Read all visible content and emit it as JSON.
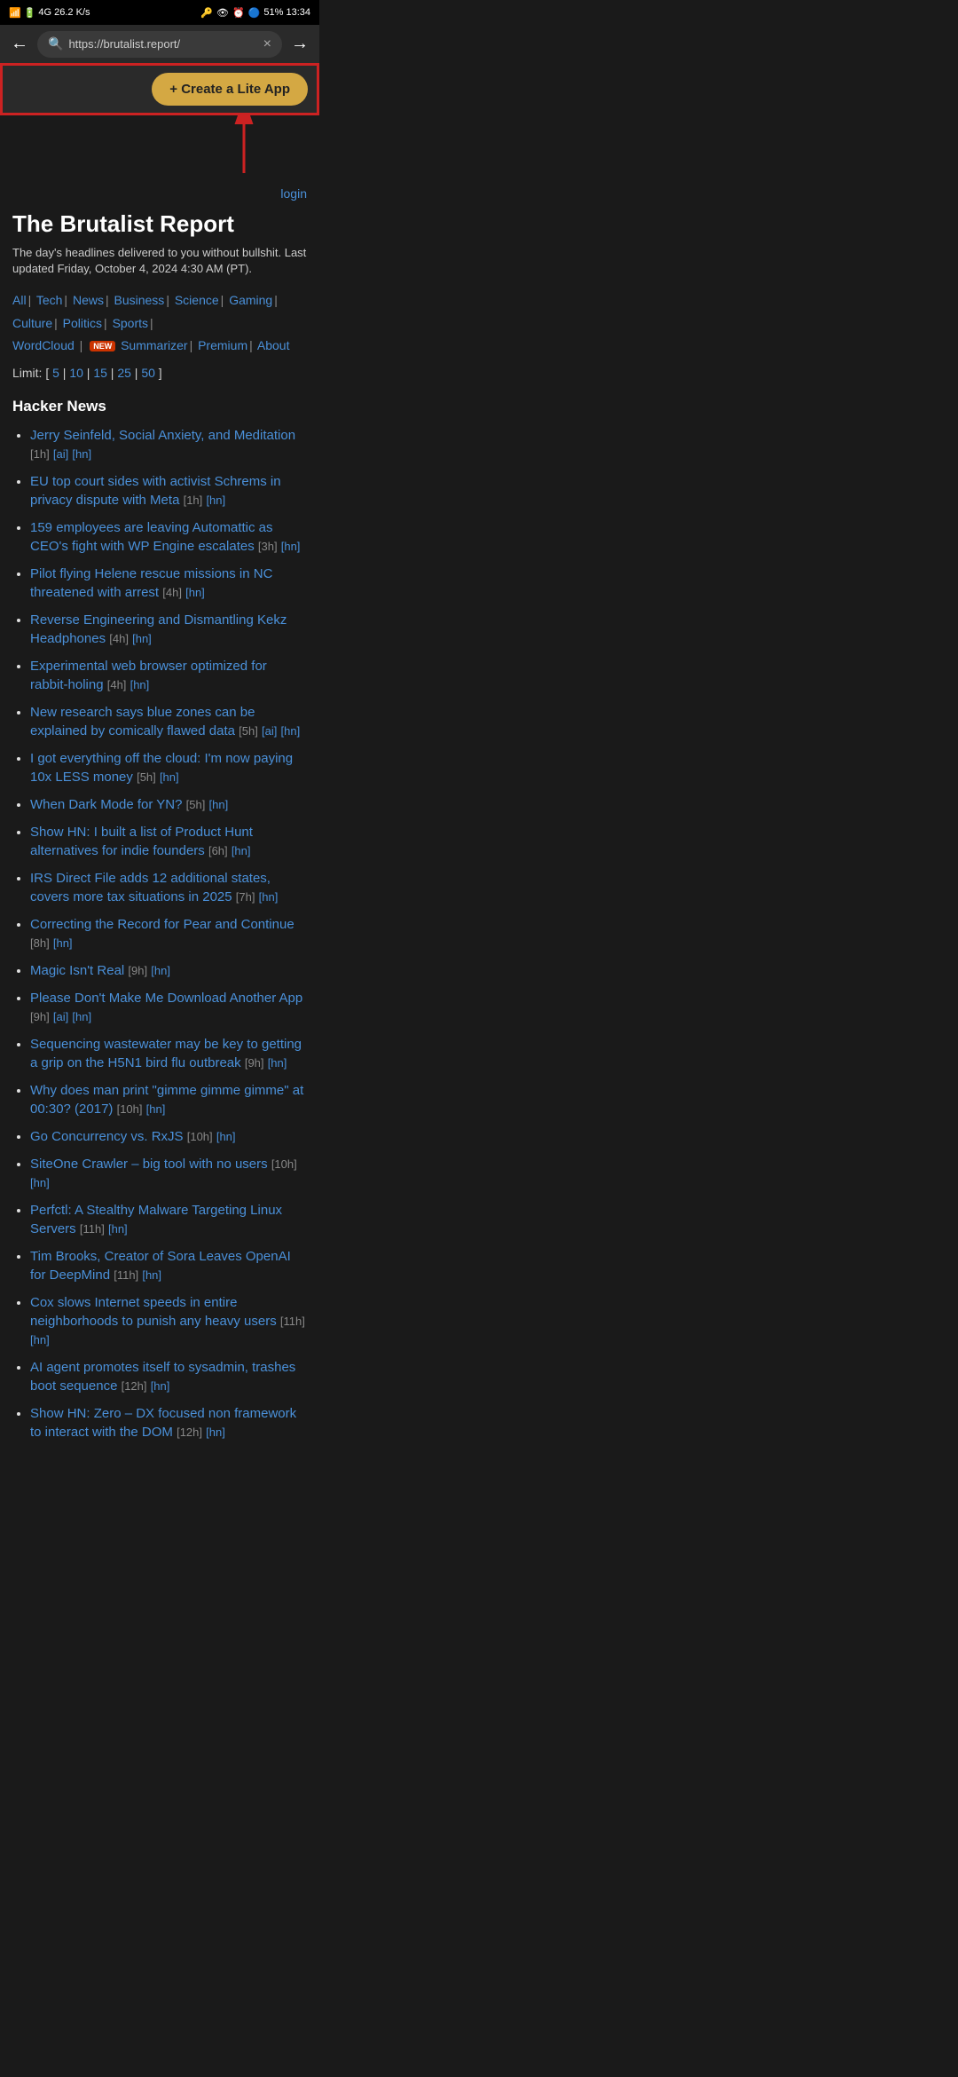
{
  "statusBar": {
    "left": "4G 26.2 K/s",
    "right": "51% 13:34"
  },
  "browser": {
    "url": "https://brutalist.report/",
    "backLabel": "←",
    "forwardLabel": "→",
    "closeLabel": "×"
  },
  "createAppBtn": {
    "label": "+ Create a Lite App"
  },
  "page": {
    "loginLabel": "login",
    "siteTitle": "The Brutalist Report",
    "siteDesc": "The day's headlines delivered to you without bullshit. Last updated Friday, October 4, 2024 4:30 AM (PT).",
    "navItems": [
      "All",
      "Tech",
      "News",
      "Business",
      "Science",
      "Gaming",
      "Culture",
      "Politics",
      "Sports",
      "WordCloud",
      "Summarizer",
      "Premium",
      "About"
    ],
    "limitLabel": "Limit:",
    "limitOptions": [
      "5",
      "10",
      "15",
      "25",
      "50"
    ],
    "hackerNewsTitle": "Hacker News",
    "newsItems": [
      {
        "title": "Jerry Seinfeld, Social Anxiety, and Meditation",
        "time": "1h",
        "tags": [
          "ai",
          "hn"
        ]
      },
      {
        "title": "EU top court sides with activist Schrems in privacy dispute with Meta",
        "time": "1h",
        "tags": [
          "hn"
        ]
      },
      {
        "title": "159 employees are leaving Automattic as CEO's fight with WP Engine escalates",
        "time": "3h",
        "tags": [
          "hn"
        ]
      },
      {
        "title": "Pilot flying Helene rescue missions in NC threatened with arrest",
        "time": "4h",
        "tags": [
          "hn"
        ]
      },
      {
        "title": "Reverse Engineering and Dismantling Kekz Headphones",
        "time": "4h",
        "tags": [
          "hn"
        ]
      },
      {
        "title": "Experimental web browser optimized for rabbit-holing",
        "time": "4h",
        "tags": [
          "hn"
        ]
      },
      {
        "title": "New research says blue zones can be explained by comically flawed data",
        "time": "5h",
        "tags": [
          "ai",
          "hn"
        ]
      },
      {
        "title": "I got everything off the cloud: I'm now paying 10x LESS money",
        "time": "5h",
        "tags": [
          "hn"
        ]
      },
      {
        "title": "When Dark Mode for YN?",
        "time": "5h",
        "tags": [
          "hn"
        ]
      },
      {
        "title": "Show HN: I built a list of Product Hunt alternatives for indie founders",
        "time": "6h",
        "tags": [
          "hn"
        ]
      },
      {
        "title": "IRS Direct File adds 12 additional states, covers more tax situations in 2025",
        "time": "7h",
        "tags": [
          "hn"
        ]
      },
      {
        "title": "Correcting the Record for Pear and Continue",
        "time": "8h",
        "tags": [
          "hn"
        ]
      },
      {
        "title": "Magic Isn't Real",
        "time": "9h",
        "tags": [
          "hn"
        ]
      },
      {
        "title": "Please Don't Make Me Download Another App",
        "time": "9h",
        "tags": [
          "ai",
          "hn"
        ]
      },
      {
        "title": "Sequencing wastewater may be key to getting a grip on the H5N1 bird flu outbreak",
        "time": "9h",
        "tags": [
          "hn"
        ]
      },
      {
        "title": "Why does man print \"gimme gimme gimme\" at 00:30? (2017)",
        "time": "10h",
        "tags": [
          "hn"
        ]
      },
      {
        "title": "Go Concurrency vs. RxJS",
        "time": "10h",
        "tags": [
          "hn"
        ]
      },
      {
        "title": "SiteOne Crawler – big tool with no users",
        "time": "10h",
        "tags": [
          "hn"
        ]
      },
      {
        "title": "Perfctl: A Stealthy Malware Targeting Linux Servers",
        "time": "11h",
        "tags": [
          "hn"
        ]
      },
      {
        "title": "Tim Brooks, Creator of Sora Leaves OpenAI for DeepMind",
        "time": "11h",
        "tags": [
          "hn"
        ]
      },
      {
        "title": "Cox slows Internet speeds in entire neighborhoods to punish any heavy users",
        "time": "11h",
        "tags": [
          "hn"
        ]
      },
      {
        "title": "AI agent promotes itself to sysadmin, trashes boot sequence",
        "time": "12h",
        "tags": [
          "hn"
        ]
      },
      {
        "title": "Show HN: Zero – DX focused non framework to interact with the DOM",
        "time": "12h",
        "tags": [
          "hn"
        ]
      }
    ]
  }
}
